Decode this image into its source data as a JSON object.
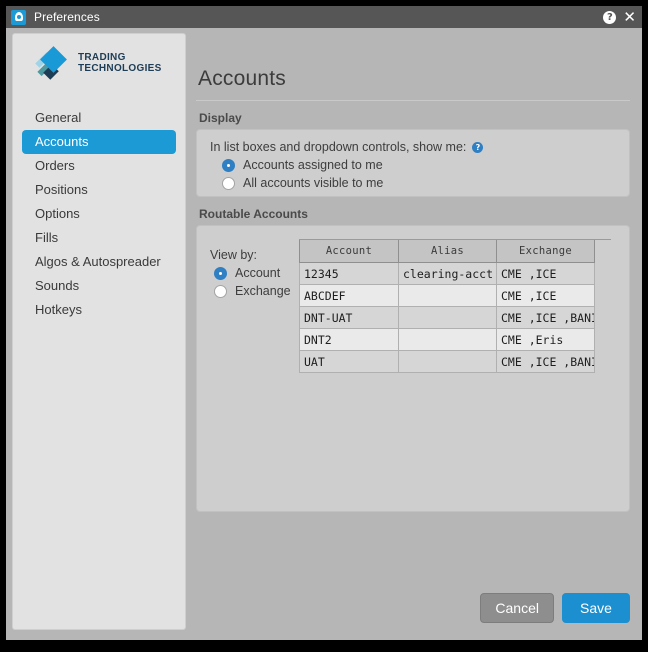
{
  "window": {
    "title": "Preferences",
    "app_icon": "preferences-gear-icon",
    "help_icon": "?",
    "close_icon": "✕"
  },
  "sidebar": {
    "logo": {
      "line1": "TRADING",
      "line2": "TECHNOLOGIES",
      "mark": "tt-diamond-logo",
      "colors": {
        "light_blue": "#9fd4e8",
        "blue": "#199ad6",
        "teal": "#4f9aa0",
        "navy": "#1d3c55"
      }
    },
    "items": [
      {
        "label": "General",
        "active": false
      },
      {
        "label": "Accounts",
        "active": true
      },
      {
        "label": "Orders",
        "active": false
      },
      {
        "label": "Positions",
        "active": false
      },
      {
        "label": "Options",
        "active": false
      },
      {
        "label": "Fills",
        "active": false
      },
      {
        "label": "Algos & Autospreader",
        "active": false
      },
      {
        "label": "Sounds",
        "active": false
      },
      {
        "label": "Hotkeys",
        "active": false
      }
    ],
    "active_color": "#1c9ad6"
  },
  "page": {
    "title": "Accounts"
  },
  "display": {
    "group_label": "Display",
    "field_label": "In list boxes and dropdown controls, show me:",
    "help_badge": "?",
    "options": [
      {
        "label": "Accounts assigned to me",
        "checked": true
      },
      {
        "label": "All accounts visible to me",
        "checked": false
      }
    ],
    "radio_color": "#2e7fc4"
  },
  "routable": {
    "group_label": "Routable Accounts",
    "view_by_label": "View by:",
    "view_by_options": [
      {
        "label": "Account",
        "checked": true
      },
      {
        "label": "Exchange",
        "checked": false
      }
    ],
    "table": {
      "columns": [
        "Account",
        "Alias",
        "Exchange"
      ],
      "rows": [
        {
          "account": "12345",
          "alias": "clearing-acct",
          "exchange": "CME ,ICE"
        },
        {
          "account": "ABCDEF",
          "alias": "",
          "exchange": "CME ,ICE"
        },
        {
          "account": "DNT-UAT",
          "alias": "",
          "exchange": "CME ,ICE ,BANI"
        },
        {
          "account": "DNT2",
          "alias": "",
          "exchange": "CME ,Eris"
        },
        {
          "account": "UAT",
          "alias": "",
          "exchange": "CME ,ICE ,BANI"
        }
      ]
    }
  },
  "footer": {
    "cancel_label": "Cancel",
    "save_label": "Save",
    "save_color": "#1b8fd0"
  }
}
